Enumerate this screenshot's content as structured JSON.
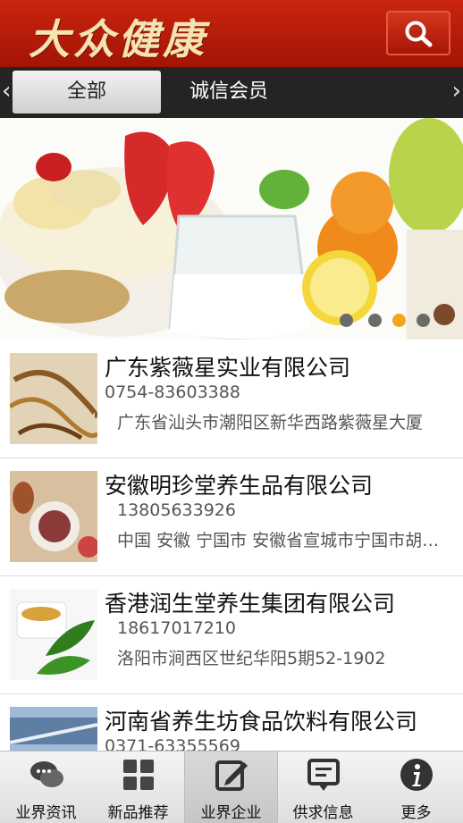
{
  "header": {
    "logo_text": "大众健康",
    "search_icon": "search-icon"
  },
  "tabs": {
    "left_arrow": "‹",
    "right_arrow": "›",
    "active_label": "全部",
    "second_label": "诚信会员"
  },
  "banner": {
    "dot_count": 4,
    "active_dot": 3
  },
  "companies": [
    {
      "name": "广东紫薇星实业有限公司",
      "phone": "0754-83603388",
      "address": "广东省汕头市潮阳区新华西路紫薇星大厦"
    },
    {
      "name": "安徽明珍堂养生品有限公司",
      "phone": "13805633926",
      "address": "中国 安徽 宁国市 安徽省宣城市宁国市胡…"
    },
    {
      "name": "香港润生堂养生集团有限公司",
      "phone": "18617017210",
      "address": "洛阳市涧西区世纪华阳5期52-1902"
    },
    {
      "name": "河南省养生坊食品饮料有限公司",
      "phone": "0371-63355569",
      "address": ""
    }
  ],
  "bottom_nav": [
    {
      "label": "业界资讯",
      "icon": "chat-bubbles-icon"
    },
    {
      "label": "新品推荐",
      "icon": "grid-icon"
    },
    {
      "label": "业界企业",
      "icon": "edit-icon"
    },
    {
      "label": "供求信息",
      "icon": "message-board-icon"
    },
    {
      "label": "更多",
      "icon": "info-icon"
    }
  ]
}
